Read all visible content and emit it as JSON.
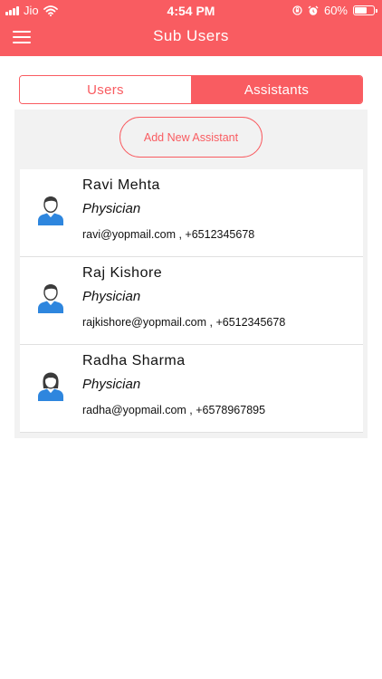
{
  "status_bar": {
    "carrier": "Jio",
    "time": "4:54 PM",
    "battery": "60%"
  },
  "header": {
    "title": "Sub Users"
  },
  "tabs": [
    {
      "label": "Users",
      "active": false
    },
    {
      "label": "Assistants",
      "active": true
    }
  ],
  "add_button": {
    "label": "Add New Assistant"
  },
  "assistants": [
    {
      "name": "Ravi Mehta",
      "role": "Physician",
      "contact": "ravi@yopmail.com , +6512345678",
      "avatar": "male-user-icon"
    },
    {
      "name": "Raj Kishore",
      "role": "Physician",
      "contact": "rajkishore@yopmail.com , +6512345678",
      "avatar": "male-user-icon"
    },
    {
      "name": "Radha Sharma",
      "role": "Physician",
      "contact": "radha@yopmail.com , +6578967895",
      "avatar": "female-user-icon"
    }
  ],
  "colors": {
    "accent": "#f95c61",
    "panel_bg": "#f2f2f2",
    "avatar_blue": "#2e86de"
  }
}
